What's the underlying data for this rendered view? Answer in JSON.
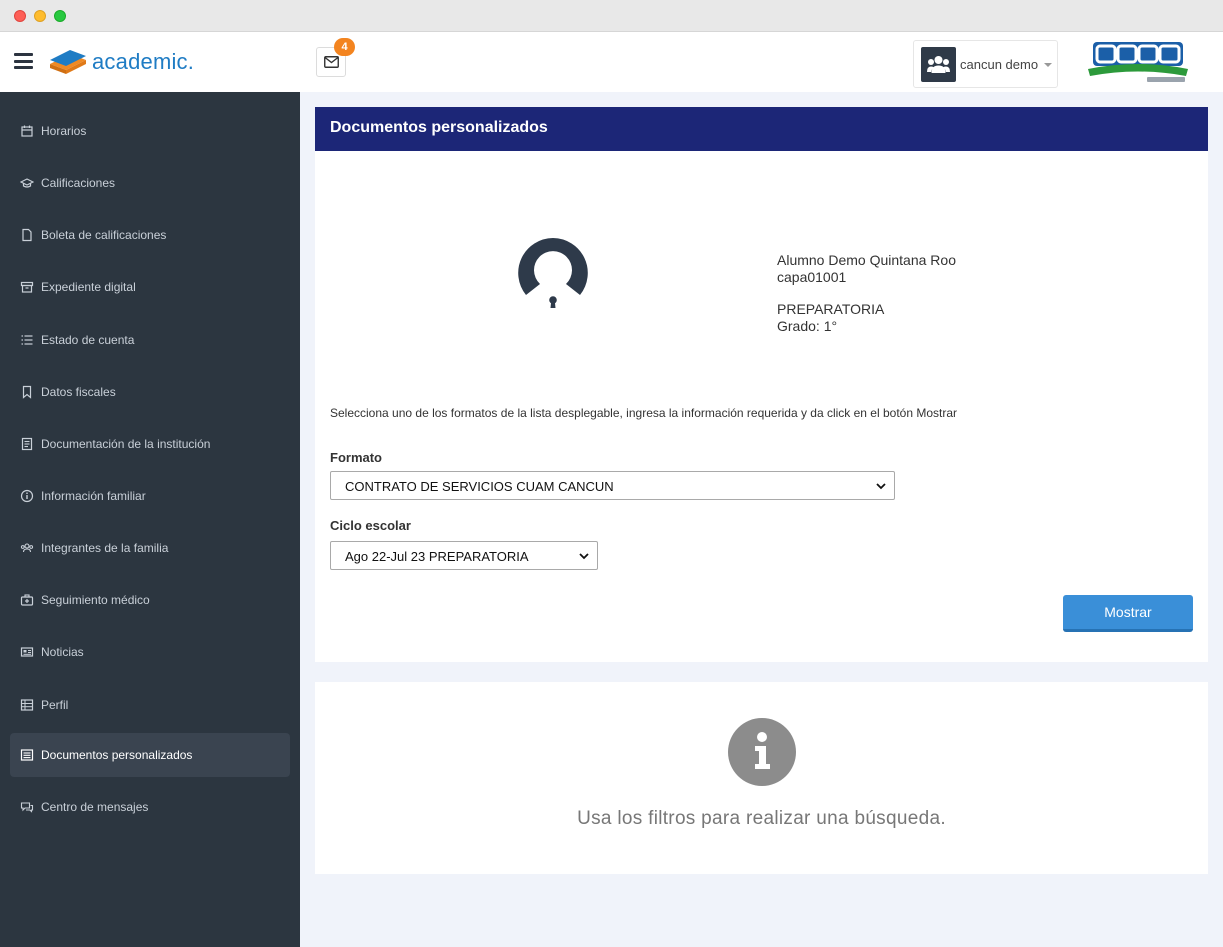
{
  "app": {
    "brand": "academic."
  },
  "topbar": {
    "notification_count": "4",
    "user_name": "cancun demo"
  },
  "sidebar": {
    "items": [
      {
        "label": "Horarios",
        "icon": "calendar-icon",
        "active": false
      },
      {
        "label": "Calificaciones",
        "icon": "graduation-cap-icon",
        "active": false
      },
      {
        "label": "Boleta de calificaciones",
        "icon": "file-icon",
        "active": false
      },
      {
        "label": "Expediente digital",
        "icon": "archive-icon",
        "active": false
      },
      {
        "label": "Estado de cuenta",
        "icon": "list-icon",
        "active": false
      },
      {
        "label": "Datos fiscales",
        "icon": "bookmark-icon",
        "active": false
      },
      {
        "label": "Documentación de la institución",
        "icon": "book-icon",
        "active": false
      },
      {
        "label": "Información familiar",
        "icon": "info-icon",
        "active": false
      },
      {
        "label": "Integrantes de la familia",
        "icon": "users-icon",
        "active": false
      },
      {
        "label": "Seguimiento médico",
        "icon": "medkit-icon",
        "active": false
      },
      {
        "label": "Noticias",
        "icon": "newspaper-icon",
        "active": false
      },
      {
        "label": "Perfil",
        "icon": "table-icon",
        "active": false
      },
      {
        "label": "Documentos personalizados",
        "icon": "document-list-icon",
        "active": true
      },
      {
        "label": "Centro de mensajes",
        "icon": "comments-icon",
        "active": false
      }
    ]
  },
  "main": {
    "title": "Documentos personalizados",
    "student": {
      "name": "Alumno Demo Quintana Roo",
      "id": "capa01001",
      "level": "PREPARATORIA",
      "grade": "Grado: 1°"
    },
    "instructions": "Selecciona uno de los formatos de la lista desplegable, ingresa la información requerida y da click en el botón Mostrar",
    "format_label": "Formato",
    "format_value": "CONTRATO DE SERVICIOS CUAM CANCUN",
    "cycle_label": "Ciclo escolar",
    "cycle_value": "Ago 22-Jul 23 PREPARATORIA",
    "show_button": "Mostrar",
    "empty_message": "Usa los filtros para realizar una búsqueda."
  },
  "colors": {
    "sidebar_bg": "#2c3640",
    "header_bg": "#1c2677",
    "accent": "#3a8fd8",
    "badge": "#f3841f",
    "brand": "#1f7cc4"
  }
}
